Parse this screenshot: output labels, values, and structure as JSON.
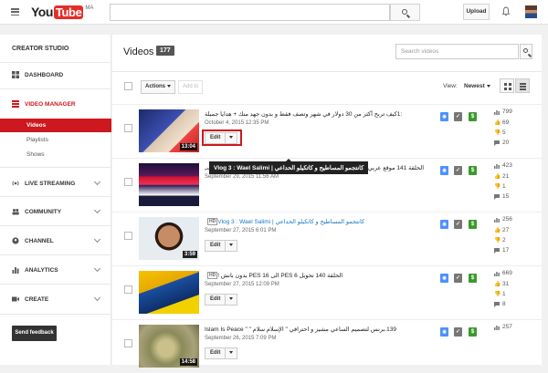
{
  "topbar": {
    "logo_you": "You",
    "logo_tube": "Tube",
    "region": "MA",
    "upload_label": "Upload"
  },
  "sidebar": {
    "heading": "CREATOR STUDIO",
    "items": [
      {
        "label": "DASHBOARD",
        "icon": "dashboard-icon"
      },
      {
        "label": "VIDEO MANAGER",
        "icon": "video-manager-icon",
        "active": true
      },
      {
        "label": "LIVE STREAMING",
        "icon": "live-streaming-icon"
      },
      {
        "label": "COMMUNITY",
        "icon": "community-icon"
      },
      {
        "label": "CHANNEL",
        "icon": "channel-icon"
      },
      {
        "label": "ANALYTICS",
        "icon": "analytics-icon"
      },
      {
        "label": "CREATE",
        "icon": "create-icon"
      }
    ],
    "subitems": [
      "Videos",
      "Playlists",
      "Shows"
    ],
    "feedback_label": "Send feedback"
  },
  "main": {
    "title": "Videos",
    "count": "177",
    "search_placeholder": "Search videos",
    "actions_label": "Actions",
    "addto_label": "Add to",
    "view_label": "View:",
    "view_value": "Newest"
  },
  "videos": [
    {
      "title": ":1كيف تربح أكثر من 30 دولار في شهر وتصف فقط و بدون جهد منك + هدايا جميلة",
      "date": "October 4, 2015 12:35 PM",
      "duration": "13:04",
      "views": "799",
      "likes": "69",
      "dislikes": "5",
      "comments": "20",
      "link": false,
      "hd": false
    },
    {
      "title": "الحلقة 141 موقع عربي يقدم لك الشروحات الحترافية للمدونات و بالمجان + طريقة التركيب",
      "date": "September 29, 2015 11:56 AM",
      "duration": "",
      "views": "423",
      "likes": "21",
      "dislikes": "1",
      "comments": "15",
      "link": false,
      "hd": false
    },
    {
      "title": "كانتجمو المساطيح و كاتكيلو الحداعي | Vlog 3 : Wael Salimi",
      "date": "September 27, 2015 6:01 PM",
      "duration": "3:59",
      "views": "256",
      "likes": "27",
      "dislikes": "2",
      "comments": "17",
      "link": true,
      "hd": true
    },
    {
      "title": "الحلقة 140 تحويل PES 6 الى PES 16 بدون بانش !",
      "date": "September 27, 2015 12:09 PM",
      "duration": "",
      "views": "669",
      "likes": "31",
      "dislikes": "1",
      "comments": "8",
      "link": false,
      "hd": true
    },
    {
      "title": "139.برنس لتصميم الساعي مشيز و احترافي \" الإسلام سلام \" \" Islam Is Peace",
      "date": "September 26, 2015 7:09 PM",
      "duration": "14:58",
      "views": "257",
      "likes": "",
      "dislikes": "",
      "comments": "",
      "link": false,
      "hd": false
    }
  ],
  "edit_label": "Edit",
  "tooltip": "Vlog 3 : Wael Salimi | كانتجمو المساطيح و كاتكيلو الحداعي"
}
